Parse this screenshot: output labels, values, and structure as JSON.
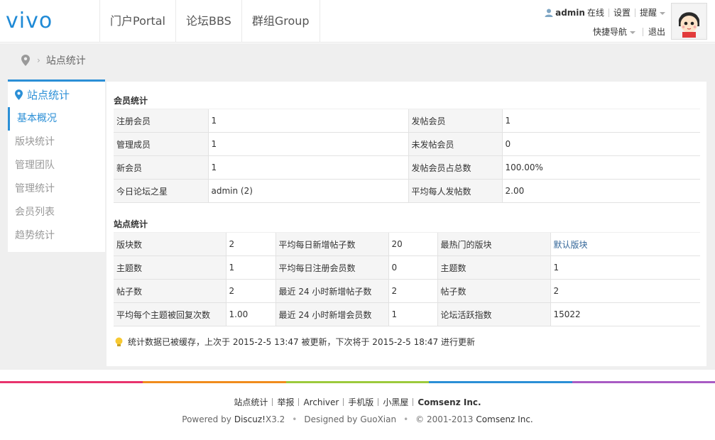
{
  "header": {
    "logo_text": "vivo",
    "nav": [
      "门户Portal",
      "论坛BBS",
      "群组Group"
    ],
    "user": {
      "name": "admin",
      "status": "在线",
      "settings": "设置",
      "alerts": "提醒",
      "quick_nav": "快捷导航",
      "logout": "退出"
    }
  },
  "breadcrumb": {
    "current": "站点统计"
  },
  "sidebar": {
    "title": "站点统计",
    "items": [
      "基本概况",
      "版块统计",
      "管理团队",
      "管理统计",
      "会员列表",
      "趋势统计"
    ],
    "active_index": 0
  },
  "member_stats": {
    "title": "会员统计",
    "rows": [
      [
        "注册会员",
        "1",
        "发帖会员",
        "1"
      ],
      [
        "管理成员",
        "1",
        "未发帖会员",
        "0"
      ],
      [
        "新会员",
        "1",
        "发帖会员占总数",
        "100.00%"
      ],
      [
        "今日论坛之星",
        "admin (2)",
        "平均每人发帖数",
        "2.00"
      ]
    ]
  },
  "site_stats": {
    "title": "站点统计",
    "rows": [
      [
        "版块数",
        "2",
        "平均每日新增帖子数",
        "20",
        "最热门的版块",
        "默认版块"
      ],
      [
        "主题数",
        "1",
        "平均每日注册会员数",
        "0",
        "主题数",
        "1"
      ],
      [
        "帖子数",
        "2",
        "最近 24 小时新增帖子数",
        "2",
        "帖子数",
        "2"
      ],
      [
        "平均每个主题被回复次数",
        "1.00",
        "最近 24 小时新增会员数",
        "1",
        "论坛活跃指数",
        "15022"
      ]
    ]
  },
  "note": "统计数据已被缓存，上次于 2015-2-5 13:47 被更新，下次将于 2015-2-5 18:47 进行更新",
  "footer": {
    "links": [
      "站点统计",
      "举报",
      "Archiver",
      "手机版",
      "小黑屋",
      "Comsenz Inc."
    ],
    "powered_prefix": "Powered by",
    "powered_name": "Discuz!",
    "powered_version": "X3.2",
    "designed_prefix": "Designed by",
    "designed_name": "GuoXian",
    "copyright": "© 2001-2013",
    "copyright_name": "Comsenz Inc."
  },
  "colors": {
    "accent": "#2b8fd6",
    "colorbar": [
      "#e8336d",
      "#f08c1d",
      "#9cca3c",
      "#2b8fd6",
      "#a95cc4"
    ]
  }
}
